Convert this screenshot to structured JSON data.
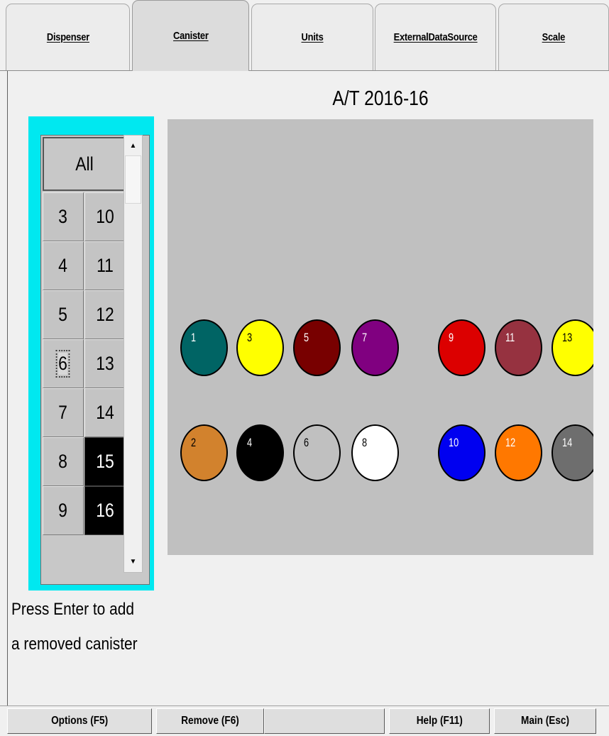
{
  "tabs": [
    {
      "label": "Dispenser",
      "active": false
    },
    {
      "label": "Canister",
      "active": true
    },
    {
      "label": "Units",
      "active": false
    },
    {
      "label": "ExternalDataSource",
      "active": false
    },
    {
      "label": "Scale",
      "active": false
    }
  ],
  "unit_title": "A/T 2016-16",
  "canister_list": {
    "all_label": "All",
    "rows": [
      [
        "3",
        "10"
      ],
      [
        "4",
        "11"
      ],
      [
        "5",
        "12"
      ],
      [
        "6",
        "13"
      ],
      [
        "7",
        "14"
      ],
      [
        "8",
        "15"
      ],
      [
        "9",
        "16"
      ]
    ],
    "focused": "6",
    "selected": [
      "15",
      "16"
    ]
  },
  "hint": {
    "line1": "Press Enter to add",
    "line2": "a removed canister"
  },
  "canisters": [
    {
      "number": "1",
      "color": "#006464",
      "text_color": "#ffffff"
    },
    {
      "number": "3",
      "color": "#ffff00",
      "text_color": "#000000"
    },
    {
      "number": "5",
      "color": "#780000",
      "text_color": "#ffffff"
    },
    {
      "number": "7",
      "color": "#800080",
      "text_color": "#ffffff"
    },
    {
      "number": "9",
      "color": "#dc0000",
      "text_color": "#ffffff"
    },
    {
      "number": "11",
      "color": "#963240",
      "text_color": "#ffffff"
    },
    {
      "number": "13",
      "color": "#ffff00",
      "text_color": "#000000"
    },
    {
      "number": "2",
      "color": "#d2822d",
      "text_color": "#000000"
    },
    {
      "number": "4",
      "color": "#000000",
      "text_color": "#ffffff"
    },
    {
      "number": "6",
      "color": "#c0c0c0",
      "text_color": "#000000"
    },
    {
      "number": "8",
      "color": "#ffffff",
      "text_color": "#000000"
    },
    {
      "number": "10",
      "color": "#0000f0",
      "text_color": "#ffffff"
    },
    {
      "number": "12",
      "color": "#ff7800",
      "text_color": "#ffffff"
    },
    {
      "number": "14",
      "color": "#6e6e6e",
      "text_color": "#ffffff"
    }
  ],
  "buttons": {
    "options": "Options (F5)",
    "remove": "Remove (F6)",
    "help": "Help (F11)",
    "main": "Main (Esc)"
  }
}
